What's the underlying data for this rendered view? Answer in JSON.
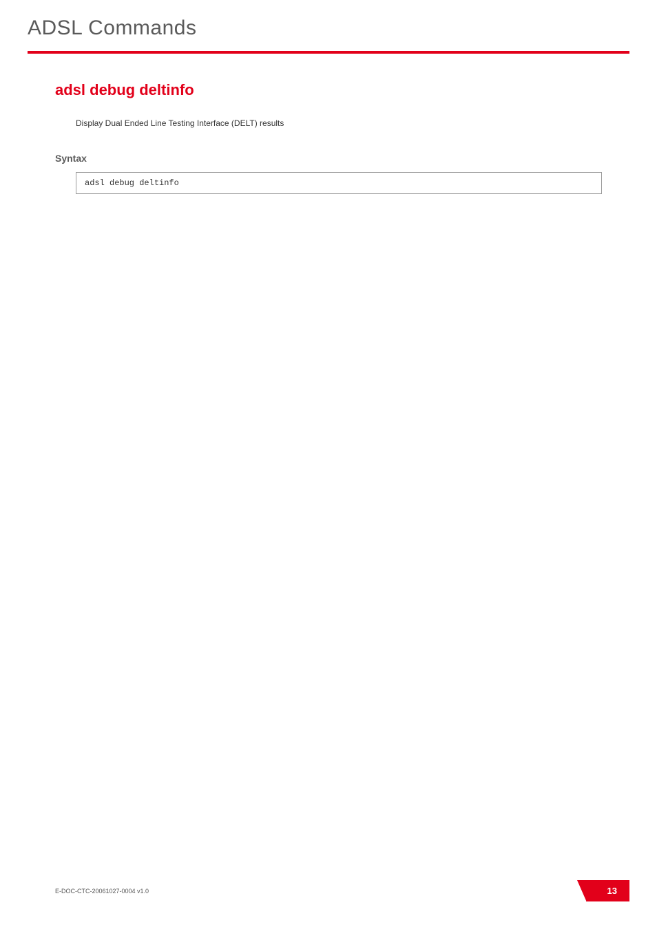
{
  "header": {
    "title": "ADSL Commands"
  },
  "content": {
    "commandTitle": "adsl debug deltinfo",
    "description": "Display Dual Ended Line Testing Interface (DELT) results",
    "syntaxHeading": "Syntax",
    "codeLine": "adsl debug deltinfo"
  },
  "footer": {
    "docId": "E-DOC-CTC-20061027-0004 v1.0",
    "pageNumber": "13"
  },
  "colors": {
    "accent": "#e2001a",
    "titleGray": "#5a5a5a"
  }
}
